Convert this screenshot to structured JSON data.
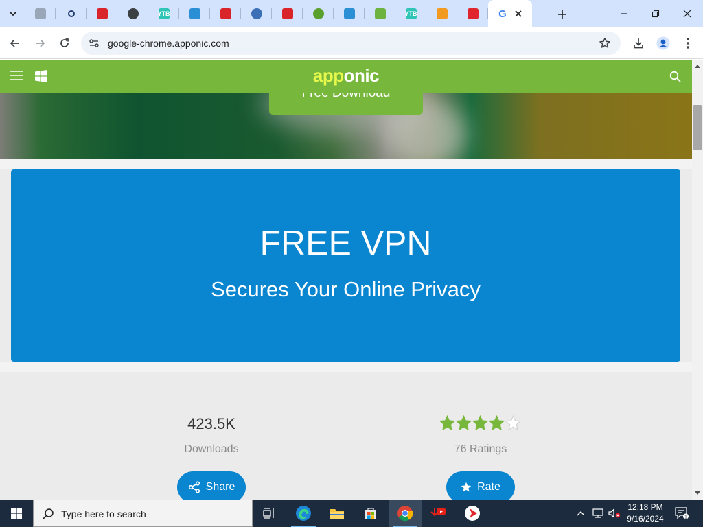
{
  "browser": {
    "tabs": [
      {
        "icon": "generic-page-icon",
        "color": "#9aa7b8"
      },
      {
        "icon": "search-icon",
        "color": "#1f3b6e"
      },
      {
        "icon": "red-download-icon",
        "color": "#d9242a"
      },
      {
        "icon": "globe-icon",
        "color": "#3c4043"
      },
      {
        "icon": "ytb-icon",
        "color": "#2ec4b6",
        "text": "YTB"
      },
      {
        "icon": "blue-arrow-icon",
        "color": "#2b8fd6"
      },
      {
        "icon": "red-download-icon",
        "color": "#d9242a"
      },
      {
        "icon": "chat-bubble-icon",
        "color": "#3b6fb6"
      },
      {
        "icon": "red-download-icon",
        "color": "#d9242a"
      },
      {
        "icon": "green-cloud-icon",
        "color": "#5aa02c"
      },
      {
        "icon": "blue-arrow-icon",
        "color": "#2b8fd6"
      },
      {
        "icon": "green-diamond-icon",
        "color": "#6db33f"
      },
      {
        "icon": "ytb-icon",
        "color": "#2ec4b6",
        "text": "YTB"
      },
      {
        "icon": "orange-swirl-icon",
        "color": "#f29a1f"
      },
      {
        "icon": "red-play-icon",
        "color": "#e0262c"
      },
      {
        "icon": "google-icon",
        "color": "#4285f4",
        "text": "G"
      }
    ],
    "url": "google-chrome.apponic.com"
  },
  "site": {
    "logo_prefix": "app",
    "logo_suffix": "onic",
    "download_button": "Free Download"
  },
  "promo": {
    "title": "FREE VPN",
    "subtitle": "Secures Your Online Privacy"
  },
  "stats": {
    "downloads_value": "423.5K",
    "downloads_label": "Downloads",
    "rating_stars": 4,
    "rating_max": 5,
    "ratings_label": "76 Ratings",
    "share_label": "Share",
    "rate_label": "Rate"
  },
  "taskbar": {
    "search_placeholder": "Type here to search",
    "time": "12:18 PM",
    "date": "9/16/2024",
    "notification_count": "1"
  },
  "colors": {
    "site_green": "#77b73c",
    "promo_blue": "#0a85d0",
    "star_green": "#77b73c"
  }
}
